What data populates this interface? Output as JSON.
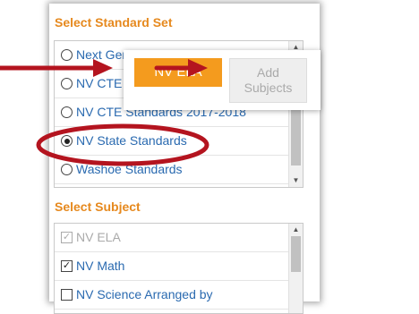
{
  "standard_set": {
    "title": "Select Standard Set",
    "items": [
      {
        "label": "Next Generation Science Standards",
        "selected": false
      },
      {
        "label": "NV CTE Standards",
        "selected": false
      },
      {
        "label": "NV CTE Standards 2017-2018",
        "selected": false
      },
      {
        "label": "NV State Standards",
        "selected": true
      },
      {
        "label": "Washoe Standards",
        "selected": false
      }
    ]
  },
  "subject": {
    "title": "Select Subject",
    "items": [
      {
        "label": "NV ELA",
        "checked": true,
        "disabled": true
      },
      {
        "label": "NV Math",
        "checked": true,
        "disabled": false
      },
      {
        "label": "NV Science Arranged by",
        "checked": false,
        "disabled": false
      }
    ]
  },
  "popup": {
    "ela_chip": "NV ELA",
    "add_subjects_line1": "Add",
    "add_subjects_line2": "Subjects"
  },
  "colors": {
    "accent_orange": "#f49b1e",
    "title_orange": "#e6891e",
    "link_blue": "#2a6ab0",
    "annotation_red": "#b4141f"
  },
  "icons": {
    "scroll_up": "▲",
    "scroll_down": "▼",
    "check": "✓"
  }
}
